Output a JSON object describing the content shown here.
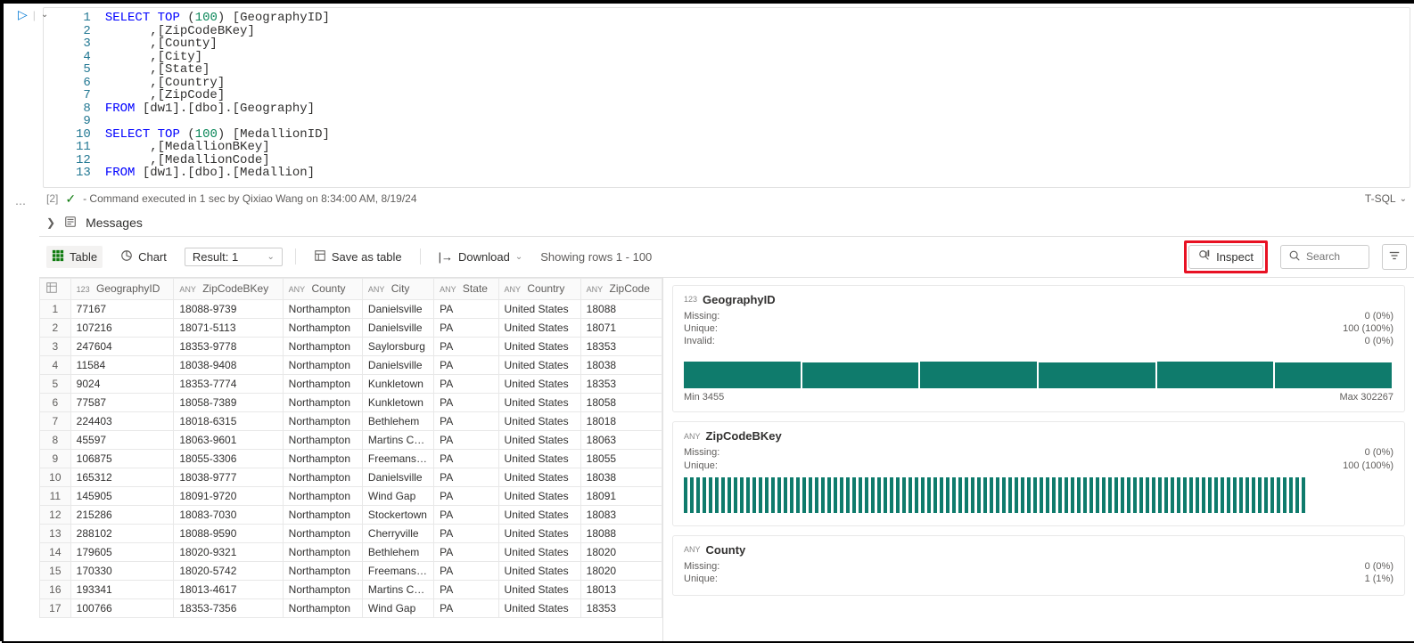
{
  "editor": {
    "lines": [
      {
        "n": "1",
        "tokens": [
          [
            "kw",
            "SELECT"
          ],
          [
            "pl",
            " "
          ],
          [
            "kw",
            "TOP"
          ],
          [
            "pl",
            " ("
          ],
          [
            "num",
            "100"
          ],
          [
            "pl",
            ") [GeographyID]"
          ]
        ]
      },
      {
        "n": "2",
        "tokens": [
          [
            "pl",
            "      ,[ZipCodeBKey]"
          ]
        ]
      },
      {
        "n": "3",
        "tokens": [
          [
            "pl",
            "      ,[County]"
          ]
        ]
      },
      {
        "n": "4",
        "tokens": [
          [
            "pl",
            "      ,[City]"
          ]
        ]
      },
      {
        "n": "5",
        "tokens": [
          [
            "pl",
            "      ,[State]"
          ]
        ]
      },
      {
        "n": "6",
        "tokens": [
          [
            "pl",
            "      ,[Country]"
          ]
        ]
      },
      {
        "n": "7",
        "tokens": [
          [
            "pl",
            "      ,[ZipCode]"
          ]
        ]
      },
      {
        "n": "8",
        "tokens": [
          [
            "kw",
            "FROM"
          ],
          [
            "pl",
            " [dw1].[dbo].[Geography]"
          ]
        ]
      },
      {
        "n": "9",
        "tokens": [
          [
            "pl",
            ""
          ]
        ]
      },
      {
        "n": "10",
        "tokens": [
          [
            "kw",
            "SELECT"
          ],
          [
            "pl",
            " "
          ],
          [
            "kw",
            "TOP"
          ],
          [
            "pl",
            " ("
          ],
          [
            "num",
            "100"
          ],
          [
            "pl",
            ") [MedallionID]"
          ]
        ]
      },
      {
        "n": "11",
        "tokens": [
          [
            "pl",
            "      ,[MedallionBKey]"
          ]
        ]
      },
      {
        "n": "12",
        "tokens": [
          [
            "pl",
            "      ,[MedallionCode]"
          ]
        ]
      },
      {
        "n": "13",
        "tokens": [
          [
            "kw",
            "FROM"
          ],
          [
            "pl",
            " [dw1].[dbo].[Medallion]"
          ]
        ]
      }
    ]
  },
  "status": {
    "cellnum": "[2]",
    "text": "- Command executed in 1 sec by Qixiao Wang on 8:34:00 AM, 8/19/24",
    "language": "T-SQL"
  },
  "messages_label": "Messages",
  "toolbar": {
    "table_label": "Table",
    "chart_label": "Chart",
    "result_label": "Result: 1",
    "save_label": "Save as table",
    "download_label": "Download",
    "rows_text": "Showing rows 1 - 100",
    "inspect_label": "Inspect",
    "search_placeholder": "Search"
  },
  "columns": [
    {
      "typ": "123",
      "name": "GeographyID",
      "cls": "col-geo"
    },
    {
      "typ": "ANY",
      "name": "ZipCodeBKey",
      "cls": "col-zipb"
    },
    {
      "typ": "ANY",
      "name": "County",
      "cls": "col-county"
    },
    {
      "typ": "ANY",
      "name": "City",
      "cls": "col-city"
    },
    {
      "typ": "ANY",
      "name": "State",
      "cls": "col-state"
    },
    {
      "typ": "ANY",
      "name": "Country",
      "cls": "col-country"
    },
    {
      "typ": "ANY",
      "name": "ZipCode",
      "cls": "col-zip"
    }
  ],
  "rows": [
    [
      "77167",
      "18088-9739",
      "Northampton",
      "Danielsville",
      "PA",
      "United States",
      "18088"
    ],
    [
      "107216",
      "18071-5113",
      "Northampton",
      "Danielsville",
      "PA",
      "United States",
      "18071"
    ],
    [
      "247604",
      "18353-9778",
      "Northampton",
      "Saylorsburg",
      "PA",
      "United States",
      "18353"
    ],
    [
      "11584",
      "18038-9408",
      "Northampton",
      "Danielsville",
      "PA",
      "United States",
      "18038"
    ],
    [
      "9024",
      "18353-7774",
      "Northampton",
      "Kunkletown",
      "PA",
      "United States",
      "18353"
    ],
    [
      "77587",
      "18058-7389",
      "Northampton",
      "Kunkletown",
      "PA",
      "United States",
      "18058"
    ],
    [
      "224403",
      "18018-6315",
      "Northampton",
      "Bethlehem",
      "PA",
      "United States",
      "18018"
    ],
    [
      "45597",
      "18063-9601",
      "Northampton",
      "Martins Cr…",
      "PA",
      "United States",
      "18063"
    ],
    [
      "106875",
      "18055-3306",
      "Northampton",
      "Freemansb…",
      "PA",
      "United States",
      "18055"
    ],
    [
      "165312",
      "18038-9777",
      "Northampton",
      "Danielsville",
      "PA",
      "United States",
      "18038"
    ],
    [
      "145905",
      "18091-9720",
      "Northampton",
      "Wind Gap",
      "PA",
      "United States",
      "18091"
    ],
    [
      "215286",
      "18083-7030",
      "Northampton",
      "Stockertown",
      "PA",
      "United States",
      "18083"
    ],
    [
      "288102",
      "18088-9590",
      "Northampton",
      "Cherryville",
      "PA",
      "United States",
      "18088"
    ],
    [
      "179605",
      "18020-9321",
      "Northampton",
      "Bethlehem",
      "PA",
      "United States",
      "18020"
    ],
    [
      "170330",
      "18020-5742",
      "Northampton",
      "Freemansb…",
      "PA",
      "United States",
      "18020"
    ],
    [
      "193341",
      "18013-4617",
      "Northampton",
      "Martins Cr…",
      "PA",
      "United States",
      "18013"
    ],
    [
      "100766",
      "18353-7356",
      "Northampton",
      "Wind Gap",
      "PA",
      "United States",
      "18353"
    ]
  ],
  "inspect": {
    "cards": [
      {
        "typ": "123",
        "name": "GeographyID",
        "stats": [
          [
            "Missing:",
            "0 (0%)"
          ],
          [
            "Unique:",
            "100 (100%)"
          ],
          [
            "Invalid:",
            "0 (0%)"
          ]
        ],
        "histo": "full",
        "bars": [
          76,
          74,
          76,
          74,
          76,
          74
        ],
        "min": "Min 3455",
        "max": "Max 302267"
      },
      {
        "typ": "ANY",
        "name": "ZipCodeBKey",
        "stats": [
          [
            "Missing:",
            "0 (0%)"
          ],
          [
            "Unique:",
            "100 (100%)"
          ]
        ],
        "histo": "comb",
        "bars": 100
      },
      {
        "typ": "ANY",
        "name": "County",
        "stats": [
          [
            "Missing:",
            "0 (0%)"
          ],
          [
            "Unique:",
            "1 (1%)"
          ]
        ]
      }
    ]
  }
}
